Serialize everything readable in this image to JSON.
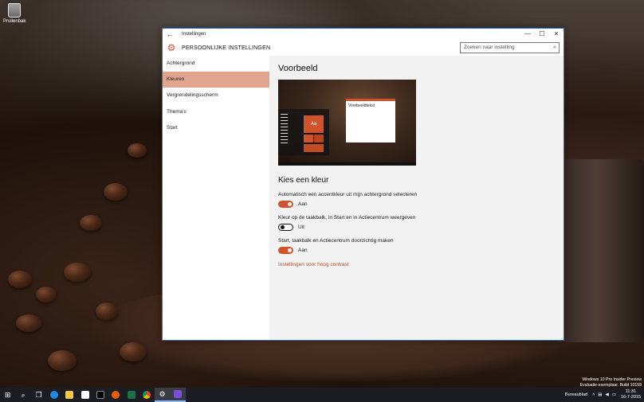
{
  "desktop": {
    "icon_label": "Prullenbak",
    "watermark": [
      "Windows 10 Pro Insider Preview",
      "Evaluatie-exemplaar. Build 10159"
    ]
  },
  "window": {
    "title": "Instellingen",
    "header": "PERSOONLIJKE INSTELLINGEN",
    "search_placeholder": "Zoeken naar instelling",
    "controls": {
      "minimize": "—",
      "maximize": "☐",
      "close": "✕"
    }
  },
  "nav": {
    "items": [
      {
        "label": "Achtergrond",
        "active": false
      },
      {
        "label": "Kleuren",
        "active": true
      },
      {
        "label": "Vergrendelingsscherm",
        "active": false
      },
      {
        "label": "Thema's",
        "active": false
      },
      {
        "label": "Start",
        "active": false
      }
    ]
  },
  "content": {
    "preview_title": "Voorbeeld",
    "preview_tile_text": "Aa",
    "preview_dialog_text": "Voorbeeldtekst",
    "color_title": "Kies een kleur",
    "options": [
      {
        "label": "Automatisch een accentkleur uit mijn achtergrond selecteren",
        "state": "Aan",
        "on": true
      },
      {
        "label": "Kleur op de taakbalk, in Start en in Actiecentrum weergeven",
        "state": "Uit",
        "on": false
      },
      {
        "label": "Start, taakbalk en Actiecentrum doorzichtig maken",
        "state": "Aan",
        "on": true
      }
    ],
    "link": "Instellingen voor hoog contrast"
  },
  "colors": {
    "accent": "#d2532b",
    "nav_active": "#e1a48d"
  },
  "taskbar": {
    "desktop_label": "Bureaublad",
    "time": "11:31",
    "date": "16-7-2015"
  }
}
